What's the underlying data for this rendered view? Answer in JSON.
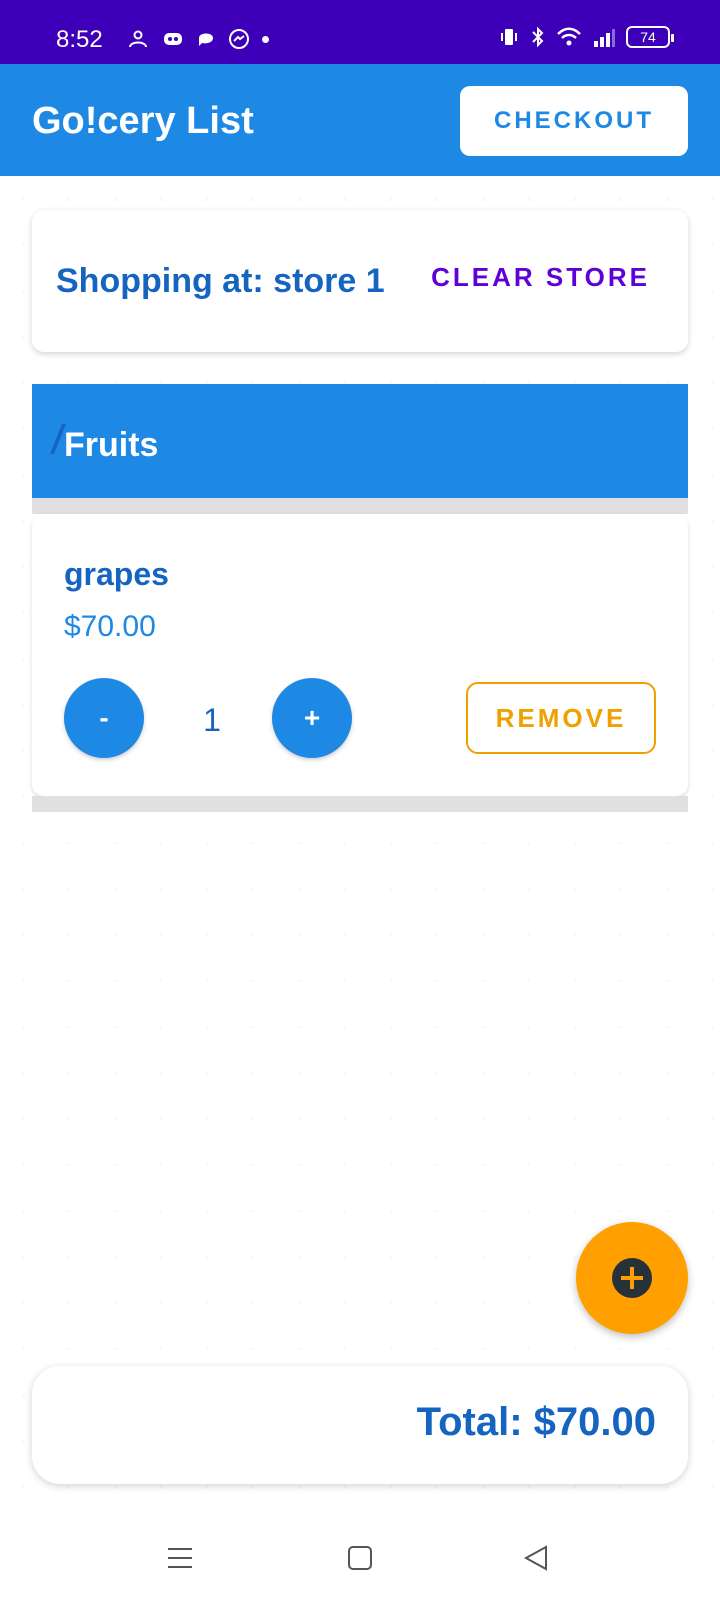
{
  "status_bar": {
    "time": "8:52",
    "battery": "74"
  },
  "app_bar": {
    "title": "Go!cery List",
    "checkout_label": "CHECKOUT"
  },
  "store_card": {
    "text": "Shopping at: store 1",
    "clear_label": "CLEAR STORE"
  },
  "category": {
    "title": "Fruits"
  },
  "item": {
    "name": "grapes",
    "price": "$70.00",
    "quantity": "1",
    "minus_label": "-",
    "plus_label": "+",
    "remove_label": "REMOVE"
  },
  "total": {
    "text": "Total: $70.00"
  },
  "colors": {
    "status_bar": "#3d00b8",
    "primary": "#1e88e5",
    "accent": "#ffa000",
    "clear_store": "#5e00d6"
  },
  "icons": {
    "fab": "add-circle-icon",
    "nav": [
      "menu-icon",
      "home-square-icon",
      "back-triangle-icon"
    ]
  }
}
